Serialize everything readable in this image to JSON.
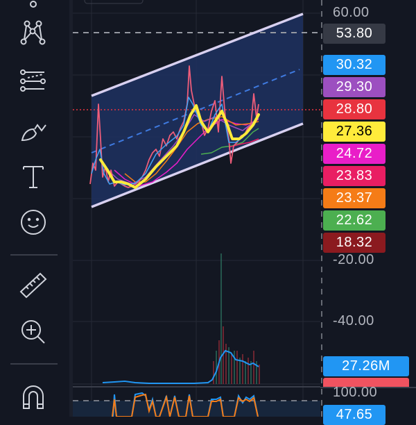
{
  "toolbar": {
    "tools": [
      {
        "name": "pattern-tool",
        "icon": "xabcd-pattern-icon"
      },
      {
        "name": "prediction-tool",
        "icon": "fib-lines-icon"
      },
      {
        "name": "brush-tool",
        "icon": "brush-icon"
      },
      {
        "name": "text-tool",
        "icon": "text-icon"
      },
      {
        "name": "emoji-tool",
        "icon": "smiley-icon"
      },
      {
        "name": "measure-tool",
        "icon": "ruler-icon"
      },
      {
        "name": "zoom-in-tool",
        "icon": "zoom-in-icon"
      },
      {
        "name": "magnet-tool",
        "icon": "magnet-icon"
      }
    ]
  },
  "price_axis": {
    "ticks": [
      "60.00",
      "-20.00",
      "-40.00",
      "100.00"
    ],
    "labels": [
      {
        "value": "53.80",
        "color": "#363a45",
        "text_color": "#ffffff"
      },
      {
        "value": "30.32",
        "color": "#2196f3",
        "text_color": "#ffffff"
      },
      {
        "value": "29.30",
        "color": "#9c4fc0",
        "text_color": "#ffffff"
      },
      {
        "value": "28.80",
        "color": "#e8333f",
        "text_color": "#ffffff"
      },
      {
        "value": "27.36",
        "color": "#ffeb3b",
        "text_color": "#000000"
      },
      {
        "value": "24.72",
        "color": "#e91ec8",
        "text_color": "#ffffff"
      },
      {
        "value": "23.83",
        "color": "#e91e63",
        "text_color": "#ffffff"
      },
      {
        "value": "23.37",
        "color": "#f57c17",
        "text_color": "#ffffff"
      },
      {
        "value": "22.62",
        "color": "#4caf50",
        "text_color": "#ffffff"
      },
      {
        "value": "18.32",
        "color": "#8b1a1f",
        "text_color": "#ffffff"
      }
    ],
    "volume_label": {
      "value": "27.26M",
      "color": "#2196f3"
    },
    "volume_label_2_color": "#f05360",
    "rsi_label": {
      "value": "47.65",
      "color": "#2196f3"
    }
  }
}
